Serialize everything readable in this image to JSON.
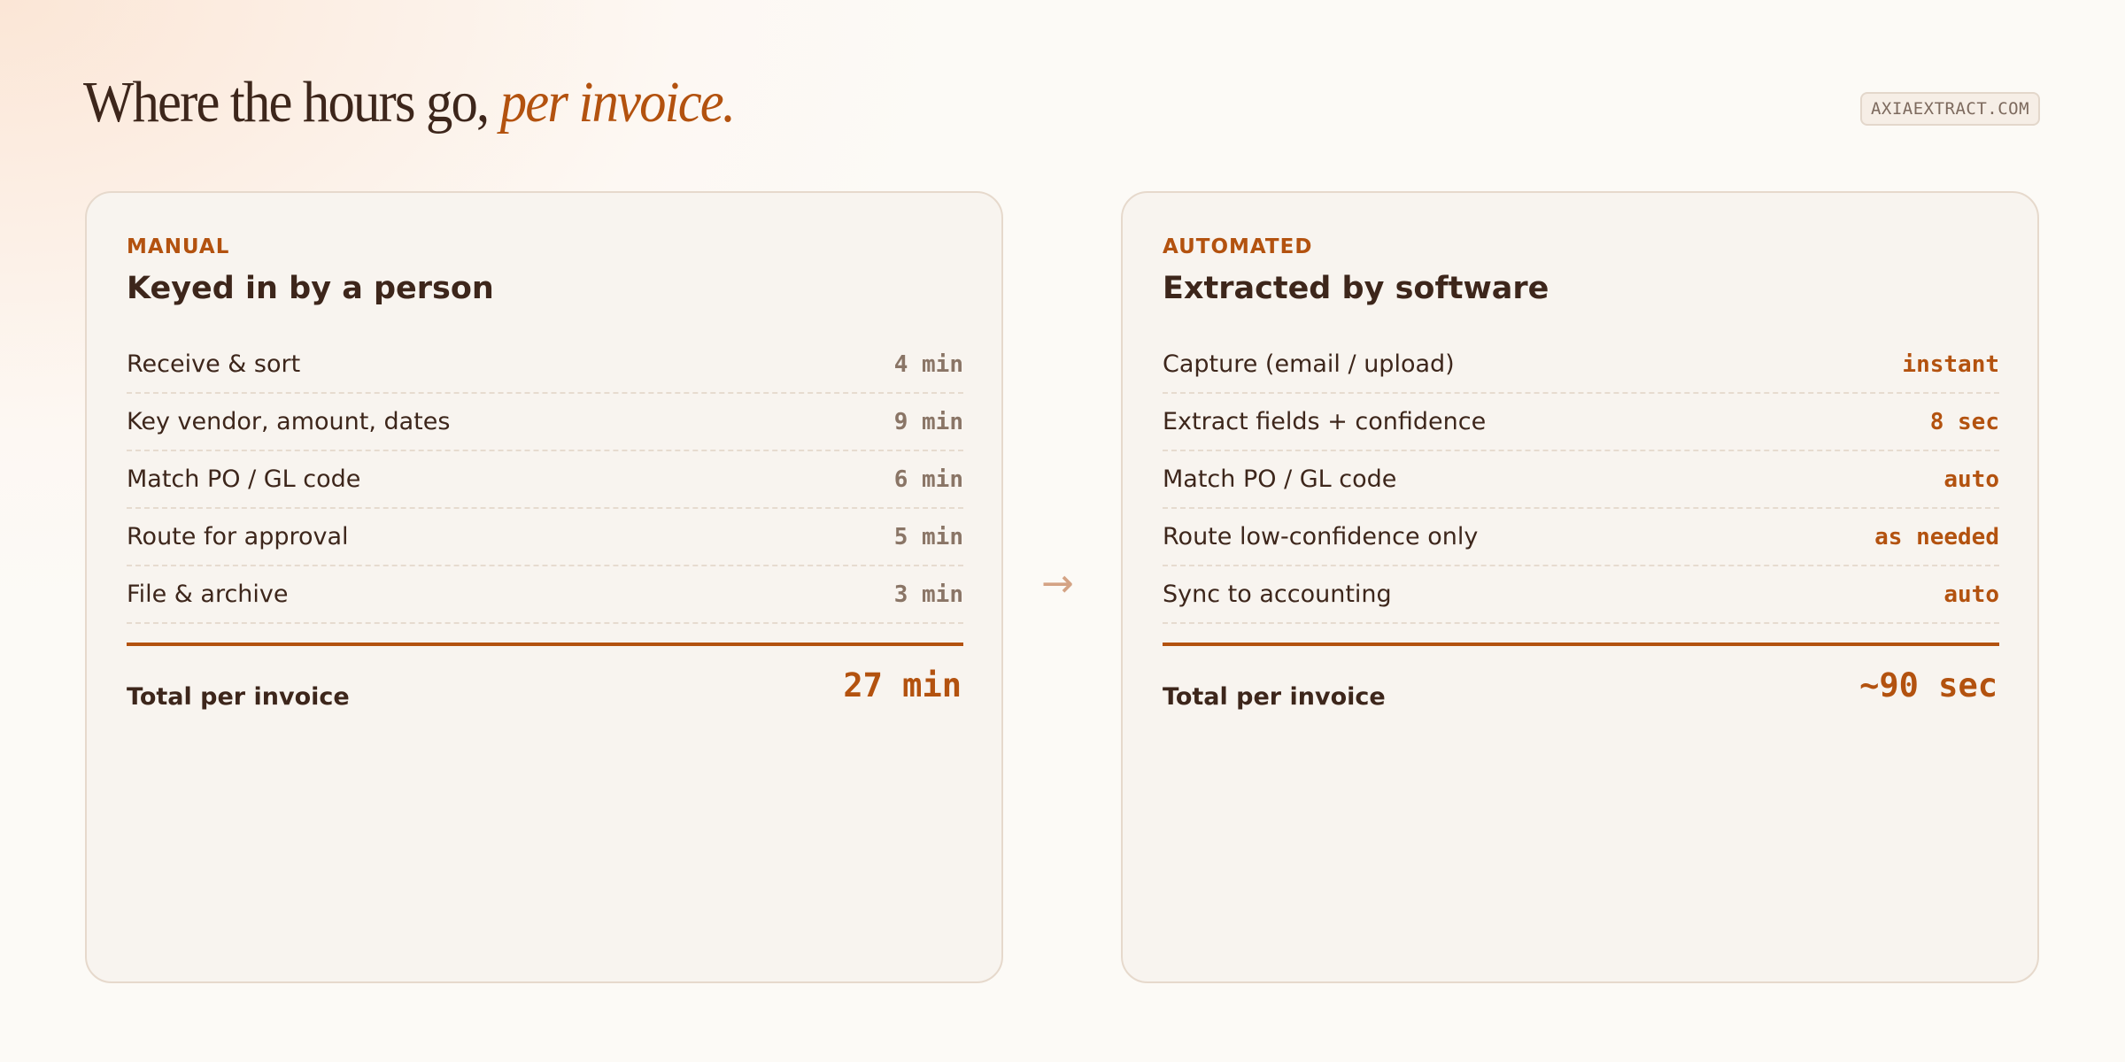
{
  "header": {
    "title_main": "Where the hours go,",
    "title_emphasis": "per invoice.",
    "domain": "AXIAEXTRACT.COM"
  },
  "manual": {
    "eyebrow": "MANUAL",
    "title": "Keyed in by a person",
    "rows": [
      {
        "label": "Receive & sort",
        "value": "4 min"
      },
      {
        "label": "Key vendor, amount, dates",
        "value": "9 min"
      },
      {
        "label": "Match PO / GL code",
        "value": "6 min"
      },
      {
        "label": "Route for approval",
        "value": "5 min"
      },
      {
        "label": "File & archive",
        "value": "3 min"
      }
    ],
    "total_label": "Total per invoice",
    "total_value": "27 min"
  },
  "automated": {
    "eyebrow": "AUTOMATED",
    "title": "Extracted by software",
    "rows": [
      {
        "label": "Capture (email / upload)",
        "value": "instant"
      },
      {
        "label": "Extract fields + confidence",
        "value": "8 sec"
      },
      {
        "label": "Match PO / GL code",
        "value": "auto"
      },
      {
        "label": "Route low-confidence only",
        "value": "as needed"
      },
      {
        "label": "Sync to accounting",
        "value": "auto"
      }
    ],
    "total_label": "Total per invoice",
    "total_value": "~90 sec"
  },
  "divider_icon": "arrow-right-icon",
  "colors": {
    "accent": "#b3520f",
    "text": "#3d261b",
    "card_bg": "#f8f4ef",
    "muted_value": "#8a7566"
  }
}
